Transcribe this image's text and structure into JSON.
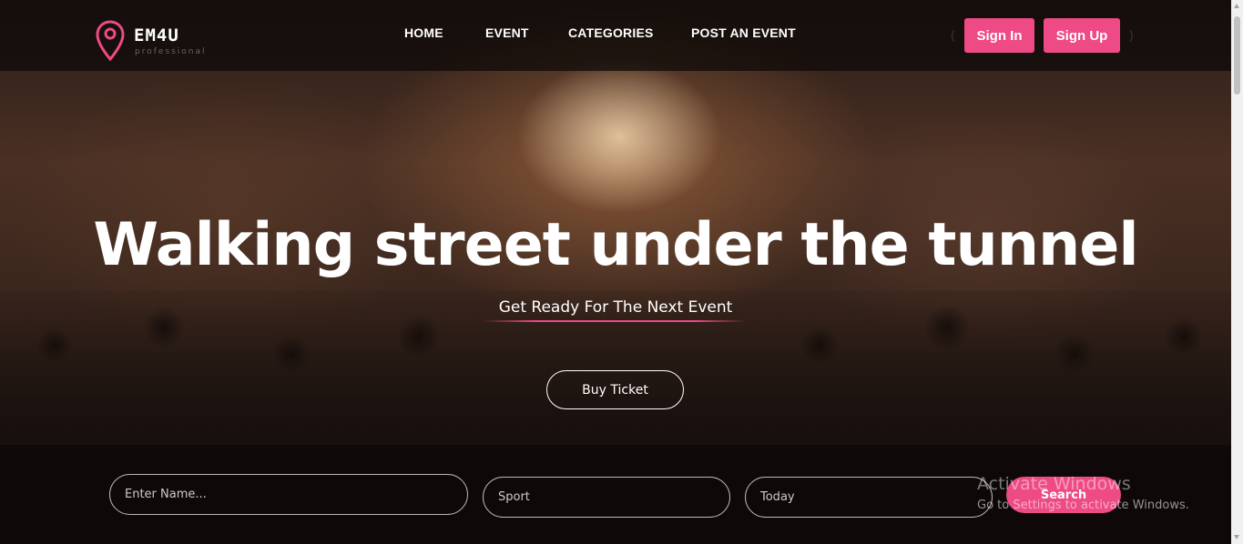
{
  "brand": {
    "name": "EM4U",
    "tagline": "professional",
    "accent_color": "#ee4a85",
    "logo_icon": "map-pin-icon"
  },
  "nav": {
    "items": [
      {
        "label": "HOME"
      },
      {
        "label": "EVENT"
      },
      {
        "label": "CATEGORIES"
      },
      {
        "label": "POST AN EVENT"
      }
    ],
    "sign_in": "Sign In",
    "sign_up": "Sign Up",
    "paren_open": "(",
    "paren_close": ")"
  },
  "hero": {
    "title": "Walking street under the tunnel",
    "subtitle": "Get Ready For The Next Event",
    "cta": "Buy Ticket"
  },
  "search": {
    "name_placeholder": "Enter Name...",
    "category_value": "Sport",
    "date_value": "Today",
    "button": "Search"
  },
  "watermark": {
    "title": "Activate Windows",
    "subtitle": "Go to Settings to activate Windows."
  }
}
